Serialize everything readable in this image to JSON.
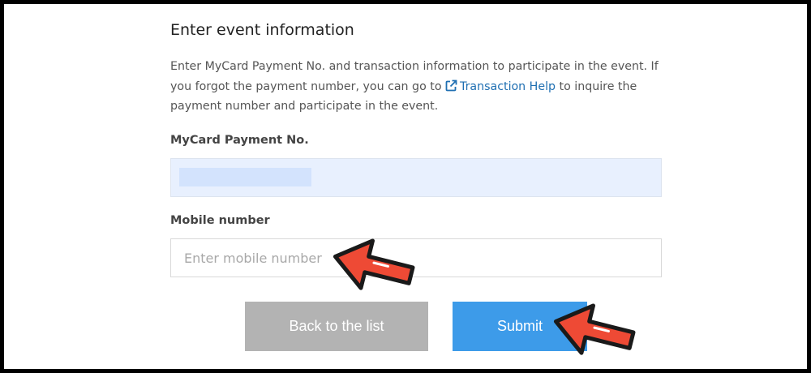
{
  "form": {
    "title": "Enter event information",
    "description_before_link": "Enter MyCard Payment No. and transaction information to participate in the event. If you forgot the payment number, you can go to ",
    "help_link_label": "Transaction Help",
    "description_after_link": " to inquire the payment number and participate in the event.",
    "payment_label": "MyCard Payment No.",
    "mobile_label": "Mobile number",
    "mobile_placeholder": "Enter mobile number"
  },
  "buttons": {
    "back_label": "Back to the list",
    "submit_label": "Submit"
  },
  "colors": {
    "link": "#1f6fb2",
    "submit": "#3d9be9",
    "back": "#b3b3b3",
    "annotation_arrow": "#ee4a35",
    "autofill_field": "#e8f0fe"
  },
  "icons": {
    "help_link": "external-link-icon",
    "annotation": "pointer-arrow-icon"
  }
}
